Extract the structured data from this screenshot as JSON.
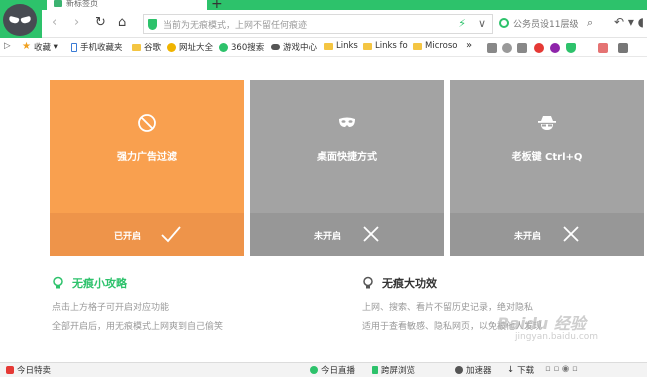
{
  "tab": {
    "title": "新标签页",
    "new_tab": "+"
  },
  "nav": {
    "back": "‹",
    "forward": "›",
    "reload": "↻",
    "home": "⌂",
    "url_text": "当前为无痕模式，上网不留任何痕迹",
    "url_dropdown": "∨",
    "search_text": "公务员设11层级",
    "search_arrow": "⌕",
    "right_controls": "↶ ▾ ◖"
  },
  "bookmarks": [
    {
      "label": "收藏",
      "icon": "star"
    },
    {
      "label": "手机收藏夹",
      "icon": "phone"
    },
    {
      "label": "谷歌",
      "icon": "folder"
    },
    {
      "label": "网址大全",
      "icon": "yellow"
    },
    {
      "label": "360搜索",
      "icon": "green"
    },
    {
      "label": "游戏中心",
      "icon": "game"
    },
    {
      "label": "Links",
      "icon": "folder"
    },
    {
      "label": "Links fo",
      "icon": "folder"
    },
    {
      "label": "Microso",
      "icon": "folder"
    }
  ],
  "bookmarks_more": "»",
  "cards": [
    {
      "title": "强力广告过滤",
      "status": "已开启",
      "state": "on",
      "icon": "block-icon"
    },
    {
      "title": "桌面快捷方式",
      "status": "未开启",
      "state": "off",
      "icon": "mask-icon"
    },
    {
      "title": "老板键 Ctrl+Q",
      "status": "未开启",
      "state": "off",
      "icon": "spy-icon"
    }
  ],
  "tips": [
    {
      "heading": "无痕小攻略",
      "color": "#2dc26b",
      "lines": [
        "点击上方格子可开启对应功能",
        "全部开启后，用无痕模式上网爽到自己偷笑"
      ]
    },
    {
      "heading": "无痕大功效",
      "color": "#333333",
      "lines": [
        "上网、搜索、看片不留历史记录，绝对隐私",
        "适用于查看敏感、隐私网页，以免被他人发现"
      ]
    }
  ],
  "statusbar": {
    "left": "今日特卖",
    "live": "今日直播",
    "cross": "跨屏浏览",
    "accel": "加速器",
    "download": "下载"
  },
  "colors": {
    "brand_green": "#2dc26b",
    "card_on": "#f9a04f",
    "card_off": "#a3a3a3"
  },
  "watermark": {
    "main": "Baidu 经验",
    "sub": "jingyan.baidu.com"
  }
}
